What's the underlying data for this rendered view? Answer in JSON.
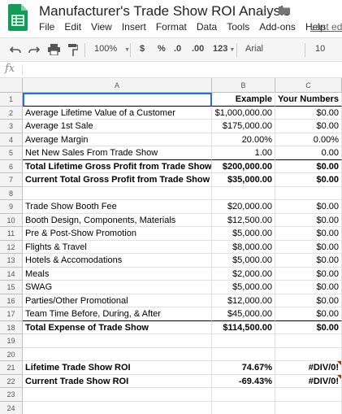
{
  "app": {
    "title": "Manufacturer's Trade Show ROI Analysis",
    "last_edit": "Last edi",
    "menu": [
      "File",
      "Edit",
      "View",
      "Insert",
      "Format",
      "Data",
      "Tools",
      "Add-ons",
      "Help"
    ]
  },
  "toolbar": {
    "zoom": "100%",
    "currency": "$",
    "percent": "%",
    "decrease_decimals": ".0",
    "increase_decimals": ".00",
    "more_formats": "123",
    "font": "Arial",
    "font_size": "10"
  },
  "formula_bar": {
    "icon": "fx",
    "value": ""
  },
  "columns": [
    "A",
    "B",
    "C"
  ],
  "rows": [
    {
      "n": "1",
      "a": "",
      "b": "Example",
      "c": "Your Numbers"
    },
    {
      "n": "2",
      "a": "Average Lifetime Value of a Customer",
      "b": "$1,000,000.00",
      "c": "$0.00"
    },
    {
      "n": "3",
      "a": "Average 1st Sale",
      "b": "$175,000.00",
      "c": "$0.00"
    },
    {
      "n": "4",
      "a": "Average Margin",
      "b": "20.00%",
      "c": "0.00%"
    },
    {
      "n": "5",
      "a": "Net New Sales From Trade Show",
      "b": "1.00",
      "c": "0.00"
    },
    {
      "n": "6",
      "a": "Total Lifetime Gross Profit from Trade Show",
      "b": "$200,000.00",
      "c": "$0.00"
    },
    {
      "n": "7",
      "a": "Current Total Gross Profit from Trade Show",
      "b": "$35,000.00",
      "c": "$0.00"
    },
    {
      "n": "8",
      "a": "",
      "b": "",
      "c": ""
    },
    {
      "n": "9",
      "a": "Trade Show Booth Fee",
      "b": "$20,000.00",
      "c": "$0.00"
    },
    {
      "n": "10",
      "a": "Booth Design, Components, Materials",
      "b": "$12,500.00",
      "c": "$0.00"
    },
    {
      "n": "11",
      "a": "Pre & Post-Show Promotion",
      "b": "$5,000.00",
      "c": "$0.00"
    },
    {
      "n": "12",
      "a": "Flights & Travel",
      "b": "$8,000.00",
      "c": "$0.00"
    },
    {
      "n": "13",
      "a": "Hotels & Accomodations",
      "b": "$5,000.00",
      "c": "$0.00"
    },
    {
      "n": "14",
      "a": "Meals",
      "b": "$2,000.00",
      "c": "$0.00"
    },
    {
      "n": "15",
      "a": "SWAG",
      "b": "$5,000.00",
      "c": "$0.00"
    },
    {
      "n": "16",
      "a": "Parties/Other Promotional",
      "b": "$12,000.00",
      "c": "$0.00"
    },
    {
      "n": "17",
      "a": "Team Time Before, During, & After",
      "b": "$45,000.00",
      "c": "$0.00"
    },
    {
      "n": "18",
      "a": "Total Expense of Trade Show",
      "b": "$114,500.00",
      "c": "$0.00"
    },
    {
      "n": "19",
      "a": "",
      "b": "",
      "c": ""
    },
    {
      "n": "20",
      "a": "",
      "b": "",
      "c": ""
    },
    {
      "n": "21",
      "a": "Lifetime Trade Show ROI",
      "b": "74.67%",
      "c": "#DIV/0!"
    },
    {
      "n": "22",
      "a": "Current Trade Show ROI",
      "b": "-69.43%",
      "c": "#DIV/0!"
    },
    {
      "n": "23",
      "a": "",
      "b": "",
      "c": ""
    },
    {
      "n": "24",
      "a": "",
      "b": "",
      "c": ""
    }
  ],
  "colors": {
    "accent": "#0f9d58",
    "selection": "#1a73e8",
    "error": "#b32d00"
  }
}
